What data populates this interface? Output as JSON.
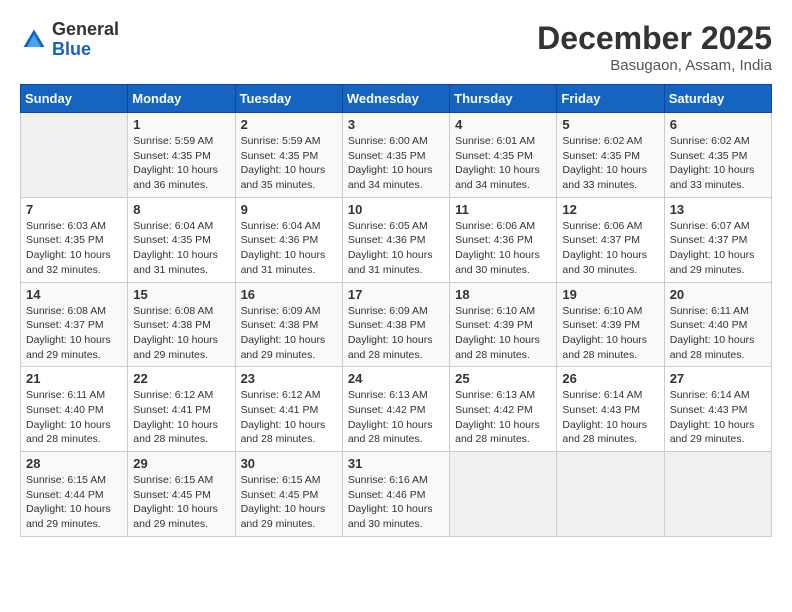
{
  "header": {
    "logo_general": "General",
    "logo_blue": "Blue",
    "month_title": "December 2025",
    "location": "Basugaon, Assam, India"
  },
  "days_of_week": [
    "Sunday",
    "Monday",
    "Tuesday",
    "Wednesday",
    "Thursday",
    "Friday",
    "Saturday"
  ],
  "weeks": [
    [
      {
        "day": "",
        "info": ""
      },
      {
        "day": "1",
        "info": "Sunrise: 5:59 AM\nSunset: 4:35 PM\nDaylight: 10 hours\nand 36 minutes."
      },
      {
        "day": "2",
        "info": "Sunrise: 5:59 AM\nSunset: 4:35 PM\nDaylight: 10 hours\nand 35 minutes."
      },
      {
        "day": "3",
        "info": "Sunrise: 6:00 AM\nSunset: 4:35 PM\nDaylight: 10 hours\nand 34 minutes."
      },
      {
        "day": "4",
        "info": "Sunrise: 6:01 AM\nSunset: 4:35 PM\nDaylight: 10 hours\nand 34 minutes."
      },
      {
        "day": "5",
        "info": "Sunrise: 6:02 AM\nSunset: 4:35 PM\nDaylight: 10 hours\nand 33 minutes."
      },
      {
        "day": "6",
        "info": "Sunrise: 6:02 AM\nSunset: 4:35 PM\nDaylight: 10 hours\nand 33 minutes."
      }
    ],
    [
      {
        "day": "7",
        "info": "Sunrise: 6:03 AM\nSunset: 4:35 PM\nDaylight: 10 hours\nand 32 minutes."
      },
      {
        "day": "8",
        "info": "Sunrise: 6:04 AM\nSunset: 4:35 PM\nDaylight: 10 hours\nand 31 minutes."
      },
      {
        "day": "9",
        "info": "Sunrise: 6:04 AM\nSunset: 4:36 PM\nDaylight: 10 hours\nand 31 minutes."
      },
      {
        "day": "10",
        "info": "Sunrise: 6:05 AM\nSunset: 4:36 PM\nDaylight: 10 hours\nand 31 minutes."
      },
      {
        "day": "11",
        "info": "Sunrise: 6:06 AM\nSunset: 4:36 PM\nDaylight: 10 hours\nand 30 minutes."
      },
      {
        "day": "12",
        "info": "Sunrise: 6:06 AM\nSunset: 4:37 PM\nDaylight: 10 hours\nand 30 minutes."
      },
      {
        "day": "13",
        "info": "Sunrise: 6:07 AM\nSunset: 4:37 PM\nDaylight: 10 hours\nand 29 minutes."
      }
    ],
    [
      {
        "day": "14",
        "info": "Sunrise: 6:08 AM\nSunset: 4:37 PM\nDaylight: 10 hours\nand 29 minutes."
      },
      {
        "day": "15",
        "info": "Sunrise: 6:08 AM\nSunset: 4:38 PM\nDaylight: 10 hours\nand 29 minutes."
      },
      {
        "day": "16",
        "info": "Sunrise: 6:09 AM\nSunset: 4:38 PM\nDaylight: 10 hours\nand 29 minutes."
      },
      {
        "day": "17",
        "info": "Sunrise: 6:09 AM\nSunset: 4:38 PM\nDaylight: 10 hours\nand 28 minutes."
      },
      {
        "day": "18",
        "info": "Sunrise: 6:10 AM\nSunset: 4:39 PM\nDaylight: 10 hours\nand 28 minutes."
      },
      {
        "day": "19",
        "info": "Sunrise: 6:10 AM\nSunset: 4:39 PM\nDaylight: 10 hours\nand 28 minutes."
      },
      {
        "day": "20",
        "info": "Sunrise: 6:11 AM\nSunset: 4:40 PM\nDaylight: 10 hours\nand 28 minutes."
      }
    ],
    [
      {
        "day": "21",
        "info": "Sunrise: 6:11 AM\nSunset: 4:40 PM\nDaylight: 10 hours\nand 28 minutes."
      },
      {
        "day": "22",
        "info": "Sunrise: 6:12 AM\nSunset: 4:41 PM\nDaylight: 10 hours\nand 28 minutes."
      },
      {
        "day": "23",
        "info": "Sunrise: 6:12 AM\nSunset: 4:41 PM\nDaylight: 10 hours\nand 28 minutes."
      },
      {
        "day": "24",
        "info": "Sunrise: 6:13 AM\nSunset: 4:42 PM\nDaylight: 10 hours\nand 28 minutes."
      },
      {
        "day": "25",
        "info": "Sunrise: 6:13 AM\nSunset: 4:42 PM\nDaylight: 10 hours\nand 28 minutes."
      },
      {
        "day": "26",
        "info": "Sunrise: 6:14 AM\nSunset: 4:43 PM\nDaylight: 10 hours\nand 28 minutes."
      },
      {
        "day": "27",
        "info": "Sunrise: 6:14 AM\nSunset: 4:43 PM\nDaylight: 10 hours\nand 29 minutes."
      }
    ],
    [
      {
        "day": "28",
        "info": "Sunrise: 6:15 AM\nSunset: 4:44 PM\nDaylight: 10 hours\nand 29 minutes."
      },
      {
        "day": "29",
        "info": "Sunrise: 6:15 AM\nSunset: 4:45 PM\nDaylight: 10 hours\nand 29 minutes."
      },
      {
        "day": "30",
        "info": "Sunrise: 6:15 AM\nSunset: 4:45 PM\nDaylight: 10 hours\nand 29 minutes."
      },
      {
        "day": "31",
        "info": "Sunrise: 6:16 AM\nSunset: 4:46 PM\nDaylight: 10 hours\nand 30 minutes."
      },
      {
        "day": "",
        "info": ""
      },
      {
        "day": "",
        "info": ""
      },
      {
        "day": "",
        "info": ""
      }
    ]
  ]
}
